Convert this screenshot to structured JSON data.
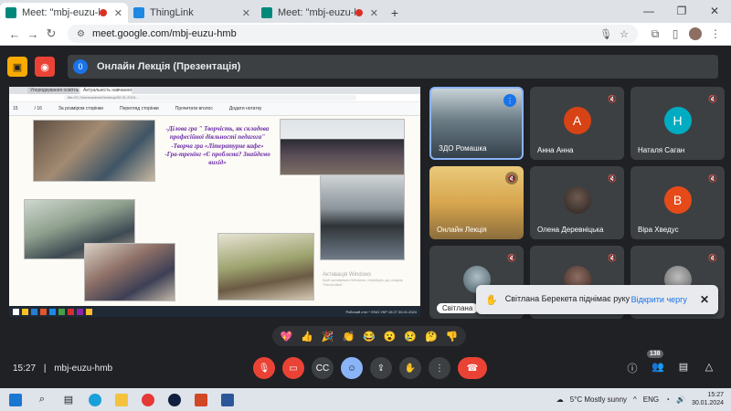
{
  "browser": {
    "tabs": [
      {
        "title": "Meet: \"mbj-euzu-hmb\"",
        "active": true,
        "recording": true
      },
      {
        "title": "ThingLink",
        "active": false,
        "recording": false
      },
      {
        "title": "Meet: \"mbj-euzu-hmb\"",
        "active": false,
        "recording": true
      }
    ],
    "new_tab": "+",
    "url": "meet.google.com/mbj-euzu-hmb"
  },
  "meet": {
    "presentation_number": "0",
    "presentation_title": "Онлайн Лекція (Презентація)",
    "shared_screen": {
      "tabs": [
        "Упорядкування освітньої...",
        "Актуальність навчання..."
      ],
      "url": "file:///C:/Users/admin/Desktop/30.01.2024...",
      "toolbar": [
        "15",
        "/ 16",
        "За розміром сторінки",
        "Перегляд сторінки",
        "Прочитати вголос",
        "Додати нотатку"
      ],
      "slide_lines": [
        "-Ділова гра \" Творчість, як складова професійної діяльності педагога\"",
        "-Творча гра «Літературне кафе»",
        "-Гра-тренінг «Є проблема? Знайдемо вихід»"
      ],
      "watermark_line1": "Активація Windows",
      "watermark_line2": "Щоб активувати Windows, перейдіть до розділу \"Настройки\".",
      "taskbar_status": "Робочий стіл   ^  ENG  УКР  15:27  30.01.2024"
    },
    "participants": [
      {
        "name": "ЗДО Ромашка",
        "type": "video",
        "speaking": true
      },
      {
        "name": "Анна Анна",
        "type": "initial",
        "initial": "А",
        "color": "#d84315",
        "muted": true
      },
      {
        "name": "Наталя Саган",
        "type": "initial",
        "initial": "Н",
        "color": "#00acc1",
        "muted": true
      },
      {
        "name": "Онлайн Лекція",
        "type": "video",
        "muted": true
      },
      {
        "name": "Олена Деревніцька",
        "type": "photo",
        "muted": true
      },
      {
        "name": "Віра Хведус",
        "type": "initial",
        "initial": "В",
        "color": "#e64a19",
        "muted": true
      },
      {
        "name": "Світлана",
        "type": "photo",
        "muted": true
      },
      {
        "name": "",
        "type": "photo",
        "muted": true
      },
      {
        "name": "",
        "type": "photo",
        "muted": true
      }
    ],
    "toast": {
      "message": "Світлана Берекета піднімає руку",
      "action": "Відкрити чергу"
    },
    "reactions": [
      "💖",
      "👍",
      "🎉",
      "👏",
      "😂",
      "😮",
      "😢",
      "🤔",
      "👎"
    ],
    "time": "15:27",
    "meeting_code": "mbj-euzu-hmb",
    "participant_count": "138"
  },
  "taskbar": {
    "weather": "5°C  Mostly sunny",
    "lang": "ENG",
    "time": "15:27",
    "date": "30.01.2024"
  }
}
